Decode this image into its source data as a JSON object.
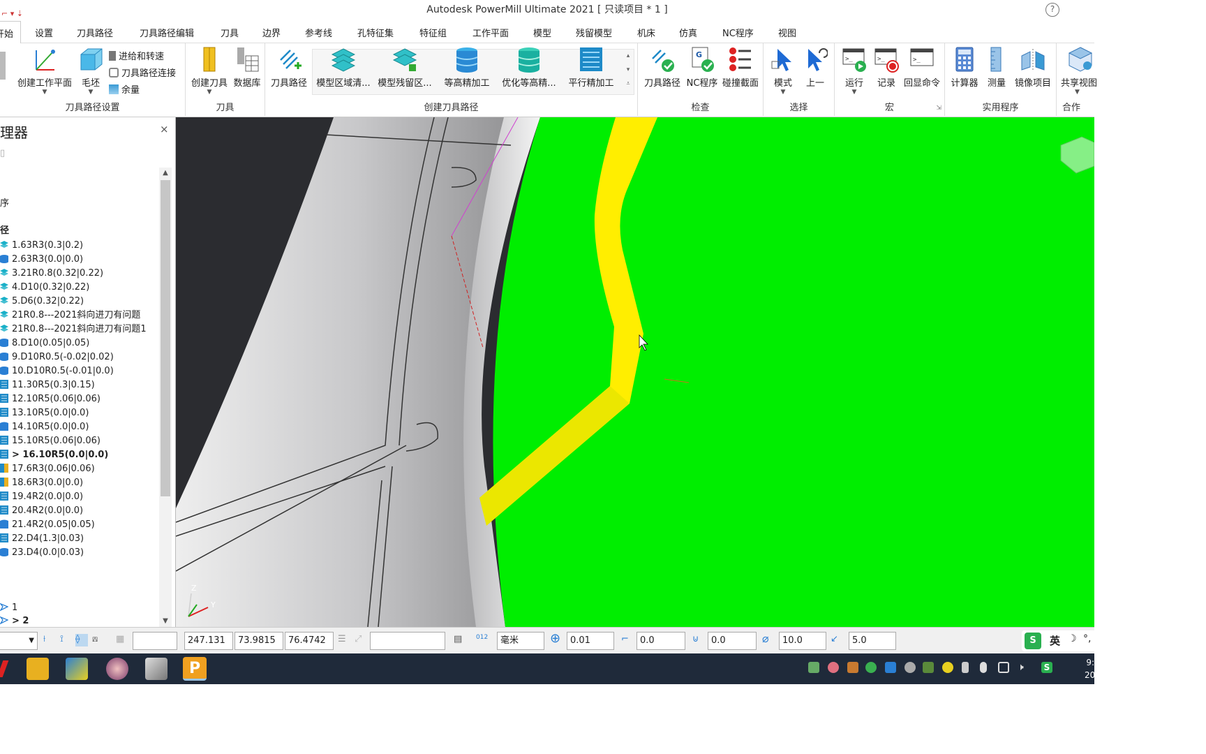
{
  "window": {
    "title": "Autodesk PowerMill Ultimate 2021    [ 只读项目 * 1 ]",
    "help": "?"
  },
  "tabs": [
    "开始",
    "设置",
    "刀具路径",
    "刀具路径编辑",
    "刀具",
    "边界",
    "参考线",
    "孔特征集",
    "特征组",
    "工作平面",
    "模型",
    "残留模型",
    "机床",
    "仿真",
    "NC程序",
    "视图"
  ],
  "ribbon": {
    "groups": {
      "toolpath_setup": "刀具路径设置",
      "tool": "刀具",
      "create_toolpath": "创建刀具路径",
      "verify": "检查",
      "select": "选择",
      "macro": "宏",
      "utilities": "实用程序",
      "collab": "合作"
    },
    "buttons": {
      "create_workplane": "创建工作平面",
      "block": "毛坯",
      "feeds_speeds": "进给和转速",
      "toolpath_connections": "刀具路径连接",
      "thickness": "余量",
      "create_tool": "创建刀具",
      "database": "数据库",
      "toolpath": "刀具路径",
      "model_area_clear": "模型区域清...",
      "model_rest_area": "模型残留区...",
      "constant_z": "等高精加工",
      "optimized_constant_z": "优化等高精...",
      "raster_finishing": "平行精加工",
      "verify_toolpath": "刀具路径",
      "verify_nc": "NC程序",
      "collision_section": "碰撞截面",
      "mode": "模式",
      "previous": "上一",
      "run": "运行",
      "record": "记录",
      "echo_commands": "回显命令",
      "calculator": "计算器",
      "measure": "测量",
      "mirror": "镜像项目",
      "share_view": "共享视图"
    }
  },
  "explorer": {
    "title": "理器",
    "close": "×",
    "tree": [
      {
        "label": "序"
      },
      {
        "label": "径"
      },
      {
        "label": "1.63R3(0.3|0.2)",
        "kind": "layers",
        "color": "#1ab0c8"
      },
      {
        "label": "2.63R3(0.0|0.0)",
        "kind": "stack",
        "color": "#2a7fd4"
      },
      {
        "label": "3.21R0.8(0.32|0.22)",
        "kind": "layers",
        "color": "#1ab0c8"
      },
      {
        "label": "4.D10(0.32|0.22)",
        "kind": "layers",
        "color": "#1ab0c8"
      },
      {
        "label": "5.D6(0.32|0.22)",
        "kind": "layers",
        "color": "#1ab0c8"
      },
      {
        "label": "21R0.8---2021斜向进刀有问题",
        "kind": "layers",
        "color": "#1ab0c8"
      },
      {
        "label": "21R0.8---2021斜向进刀有问题1",
        "kind": "layers",
        "color": "#1ab0c8"
      },
      {
        "label": "8.D10(0.05|0.05)",
        "kind": "stack",
        "color": "#2a7fd4"
      },
      {
        "label": "9.D10R0.5(-0.02|0.02)",
        "kind": "stack",
        "color": "#2a7fd4"
      },
      {
        "label": "10.D10R0.5(-0.01|0.0)",
        "kind": "stack",
        "color": "#2a7fd4"
      },
      {
        "label": "11.30R5(0.3|0.15)",
        "kind": "raster",
        "color": "#1e8ac8"
      },
      {
        "label": "12.10R5(0.06|0.06)",
        "kind": "raster",
        "color": "#1e8ac8"
      },
      {
        "label": "13.10R5(0.0|0.0)",
        "kind": "raster",
        "color": "#1e8ac8"
      },
      {
        "label": "14.10R5(0.0|0.0)",
        "kind": "shape",
        "color": "#2a7fd4"
      },
      {
        "label": "15.10R5(0.06|0.06)",
        "kind": "raster",
        "color": "#1e8ac8"
      },
      {
        "label": "> 16.10R5(0.0|0.0)",
        "kind": "raster",
        "color": "#1e8ac8",
        "current": true
      },
      {
        "label": "17.6R3(0.06|0.06)",
        "kind": "pencil",
        "color": "#e8b020"
      },
      {
        "label": "18.6R3(0.0|0.0)",
        "kind": "pencil",
        "color": "#e8b020"
      },
      {
        "label": "19.4R2(0.0|0.0)",
        "kind": "raster",
        "color": "#1e8ac8"
      },
      {
        "label": "20.4R2(0.0|0.0)",
        "kind": "raster",
        "color": "#1e8ac8"
      },
      {
        "label": "21.4R2(0.05|0.05)",
        "kind": "shape",
        "color": "#2a7fd4"
      },
      {
        "label": "22.D4(1.3|0.03)",
        "kind": "raster",
        "color": "#1e8ac8"
      },
      {
        "label": "23.D4(0.0|0.03)",
        "kind": "stack",
        "color": "#2a7fd4"
      }
    ],
    "nc_items": [
      {
        "label": "1"
      },
      {
        "label": "> 2",
        "current": true
      }
    ]
  },
  "viewport": {
    "axis": {
      "z": "Z",
      "y": "Y"
    },
    "colors": {
      "bg": "#2b2c30",
      "stock": "#00ee00",
      "path": "#ffee00",
      "part": "#d4d4d6"
    }
  },
  "status": {
    "x": "247.131",
    "y": "73.9815",
    "z": "76.4742",
    "units": "毫米",
    "tolerance": "0.01",
    "thickness": "0.0",
    "axial_thickness": "0.0",
    "diameter": "10.0",
    "stepover": "5.0"
  },
  "taskbar": {
    "ime": "英",
    "clock": "9:",
    "date": "20"
  }
}
